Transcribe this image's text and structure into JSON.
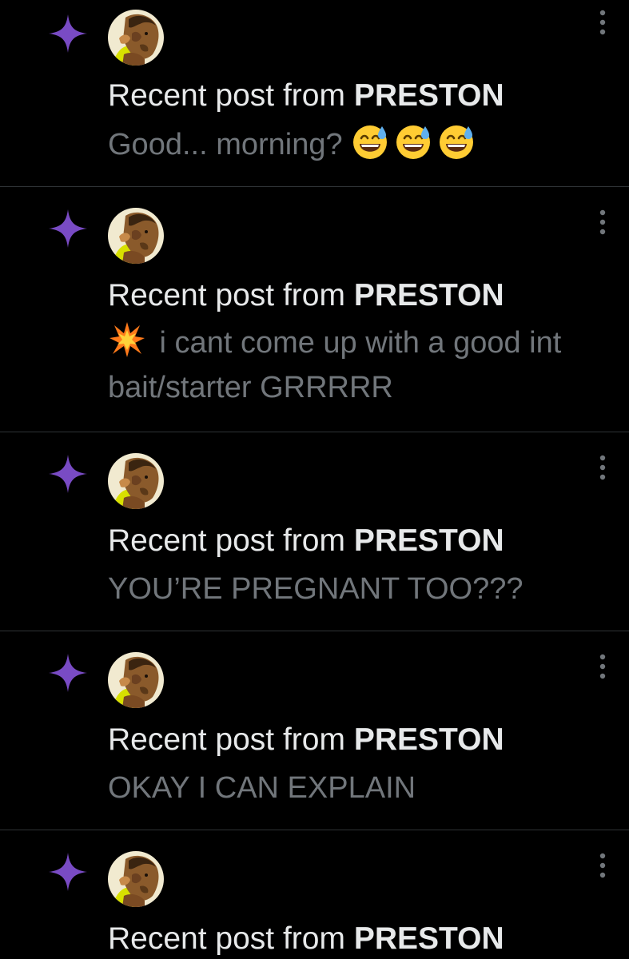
{
  "notifications": [
    {
      "headline_prefix": "Recent post from",
      "author": "PRESTON",
      "text": "Good... morning?",
      "emoji": [
        "sweat-smile-emoji",
        "sweat-smile-emoji",
        "sweat-smile-emoji"
      ]
    },
    {
      "headline_prefix": "Recent post from",
      "author": "PRESTON",
      "lead_emoji": "collision-emoji",
      "text": "i cant come up with a good int bait/starter GRRRRR"
    },
    {
      "headline_prefix": "Recent post from",
      "author": "PRESTON",
      "text": "YOU’RE PREGNANT TOO???"
    },
    {
      "headline_prefix": "Recent post from",
      "author": "PRESTON",
      "text": "OKAY I CAN EXPLAIN"
    },
    {
      "headline_prefix": "Recent post from",
      "author": "PRESTON"
    }
  ],
  "colors": {
    "background": "#000000",
    "divider": "#2f3336",
    "primary_text": "#e7e9ea",
    "secondary_text": "#71767b",
    "sparkle": "#794bc4"
  },
  "icons": {
    "notification_type": "sparkle-icon",
    "menu": "more-vertical-icon"
  }
}
